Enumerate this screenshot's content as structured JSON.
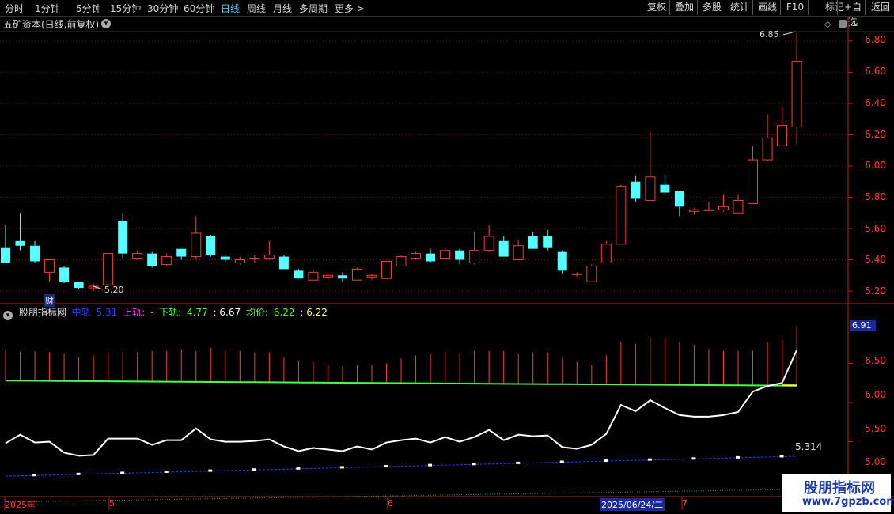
{
  "toolbar": {
    "periods": [
      "分时",
      "1分钟",
      "5分钟",
      "15分钟",
      "30分钟",
      "60分钟",
      "日线",
      "周线",
      "月线",
      "多周期",
      "更多"
    ],
    "active_period": "日线",
    "right_buttons": [
      "复权",
      "叠加",
      "多股",
      "统计",
      "画线",
      "F10",
      "+自选",
      "返回"
    ],
    "prev_icon": "chevron-left-icon",
    "more_icon": "chevron-right-icon"
  },
  "main_panel": {
    "title": "五矿资本(日线,前复权)",
    "high_marker": "6.85",
    "low_marker": "5.20",
    "finance_badge": "财",
    "axis_ticks": [
      "6.80",
      "6.60",
      "6.40",
      "6.20",
      "6.00",
      "5.80",
      "5.60",
      "5.40",
      "5.20"
    ]
  },
  "indicator": {
    "name": "股朋指标网",
    "mid_label": "中轨",
    "mid_value": "5.31",
    "upper_label": "上轨:",
    "upper_value": "-",
    "lower_label": "下轨:",
    "lower_value": "4.77",
    "value4": ": 6.67",
    "avg_label": "均价:",
    "avg_value": "6.22",
    "value6": ": 6.22",
    "axis_ticks": [
      "6.50",
      "6.00",
      "5.50",
      "5.00"
    ],
    "current_box": "6.91",
    "line_label": "5.314"
  },
  "dates": {
    "year": "2025年",
    "m5": "5",
    "m6": "6",
    "cursor_date": "2025/06/24/二",
    "m7": "7"
  },
  "watermark": {
    "line1": "股朋指标网",
    "line2": "www.7gpzb.com"
  },
  "colors": {
    "up": "#ff3b3b",
    "down": "#54ffff",
    "active_tab": "#3fd6ff",
    "mid_line": "#2a3cff",
    "upper_line": "#ff44ff",
    "green_line": "#44ff44",
    "white_line": "#ffffff"
  },
  "chart_data": {
    "type": "candlestick",
    "ohlc": [
      [
        5.48,
        5.62,
        5.38,
        5.38
      ],
      [
        5.52,
        5.7,
        5.46,
        5.49
      ],
      [
        5.49,
        5.52,
        5.38,
        5.39
      ],
      [
        5.32,
        5.4,
        5.26,
        5.4
      ],
      [
        5.35,
        5.36,
        5.25,
        5.26
      ],
      [
        5.26,
        5.26,
        5.21,
        5.22
      ],
      [
        5.22,
        5.25,
        5.2,
        5.23
      ],
      [
        5.24,
        5.44,
        5.23,
        5.44
      ],
      [
        5.65,
        5.7,
        5.41,
        5.44
      ],
      [
        5.41,
        5.46,
        5.4,
        5.44
      ],
      [
        5.44,
        5.45,
        5.35,
        5.36
      ],
      [
        5.37,
        5.44,
        5.36,
        5.42
      ],
      [
        5.47,
        5.47,
        5.4,
        5.42
      ],
      [
        5.42,
        5.68,
        5.4,
        5.57
      ],
      [
        5.55,
        5.56,
        5.42,
        5.43
      ],
      [
        5.42,
        5.43,
        5.39,
        5.4
      ],
      [
        5.38,
        5.42,
        5.37,
        5.4
      ],
      [
        5.41,
        5.43,
        5.38,
        5.41
      ],
      [
        5.41,
        5.52,
        5.4,
        5.43
      ],
      [
        5.42,
        5.43,
        5.34,
        5.34
      ],
      [
        5.33,
        5.34,
        5.28,
        5.28
      ],
      [
        5.27,
        5.33,
        5.27,
        5.32
      ],
      [
        5.29,
        5.31,
        5.27,
        5.3
      ],
      [
        5.3,
        5.32,
        5.26,
        5.28
      ],
      [
        5.27,
        5.35,
        5.27,
        5.34
      ],
      [
        5.29,
        5.31,
        5.27,
        5.3
      ],
      [
        5.28,
        5.37,
        5.28,
        5.39
      ],
      [
        5.36,
        5.43,
        5.36,
        5.42
      ],
      [
        5.41,
        5.45,
        5.4,
        5.44
      ],
      [
        5.44,
        5.47,
        5.38,
        5.39
      ],
      [
        5.41,
        5.48,
        5.41,
        5.46
      ],
      [
        5.46,
        5.47,
        5.37,
        5.4
      ],
      [
        5.38,
        5.58,
        5.37,
        5.46
      ],
      [
        5.46,
        5.62,
        5.45,
        5.55
      ],
      [
        5.52,
        5.55,
        5.42,
        5.42
      ],
      [
        5.4,
        5.53,
        5.4,
        5.49
      ],
      [
        5.55,
        5.58,
        5.48,
        5.47
      ],
      [
        5.55,
        5.59,
        5.46,
        5.48
      ],
      [
        5.45,
        5.46,
        5.31,
        5.33
      ],
      [
        5.31,
        5.32,
        5.29,
        5.31
      ],
      [
        5.26,
        5.37,
        5.26,
        5.36
      ],
      [
        5.38,
        5.52,
        5.38,
        5.5
      ],
      [
        5.5,
        5.88,
        5.5,
        5.87
      ],
      [
        5.9,
        5.94,
        5.77,
        5.79
      ],
      [
        5.78,
        6.22,
        5.78,
        5.93
      ],
      [
        5.88,
        5.95,
        5.82,
        5.83
      ],
      [
        5.84,
        5.84,
        5.68,
        5.74
      ],
      [
        5.71,
        5.73,
        5.69,
        5.72
      ],
      [
        5.72,
        5.77,
        5.71,
        5.72
      ],
      [
        5.72,
        5.82,
        5.71,
        5.74
      ],
      [
        5.7,
        5.82,
        5.7,
        5.78
      ],
      [
        5.76,
        6.13,
        5.76,
        6.04
      ],
      [
        6.04,
        6.33,
        6.03,
        6.18
      ],
      [
        6.13,
        6.38,
        6.13,
        6.26
      ],
      [
        6.25,
        6.85,
        6.14,
        6.67
      ]
    ]
  }
}
